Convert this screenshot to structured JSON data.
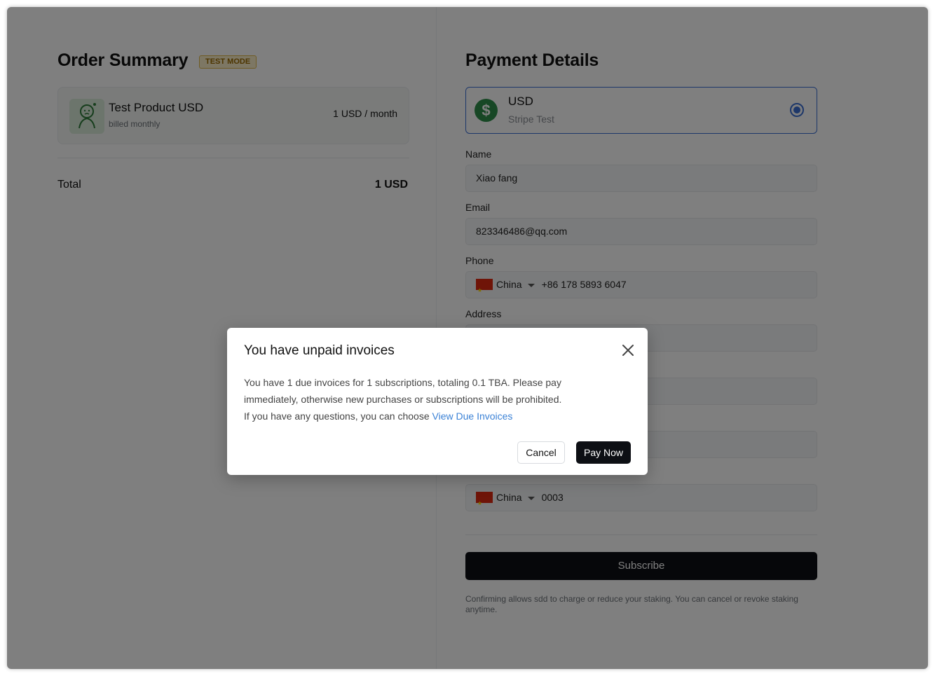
{
  "order_summary": {
    "title": "Order Summary",
    "badge": "TEST MODE",
    "product": {
      "name": "Test Product USD",
      "billing": "billed monthly",
      "price": "1 USD / month"
    },
    "total_label": "Total",
    "total_value": "1 USD"
  },
  "payment_details": {
    "title": "Payment Details",
    "method": {
      "currency": "USD",
      "provider": "Stripe Test",
      "icon": "dollar-icon"
    },
    "name_label": "Name",
    "name_value": "Xiao fang",
    "email_label": "Email",
    "email_value": "823346486@qq.com",
    "phone_label": "Phone",
    "phone_country": "China",
    "phone_value": "+86 178 5893 6047",
    "address_label": "Address",
    "postal_country": "China",
    "postal_value": "0003",
    "subscribe_label": "Subscribe",
    "confirm_note": "Confirming allows sdd to charge or reduce your staking. You can cancel or revoke staking anytime."
  },
  "modal": {
    "title": "You have unpaid invoices",
    "body_line1": "You have 1 due invoices for 1 subscriptions, totaling 0.1 TBA. Please pay",
    "body_line2": "immediately, otherwise new purchases or subscriptions will be prohibited.",
    "body_line3": "If you have any questions, you can choose ",
    "link_text": "View Due Invoices",
    "cancel_label": "Cancel",
    "pay_label": "Pay Now"
  },
  "colors": {
    "accent": "#3b6fd4",
    "link": "#3b82d6",
    "primary_button": "#0d0f14",
    "dollar_icon": "#2f8f4a"
  }
}
